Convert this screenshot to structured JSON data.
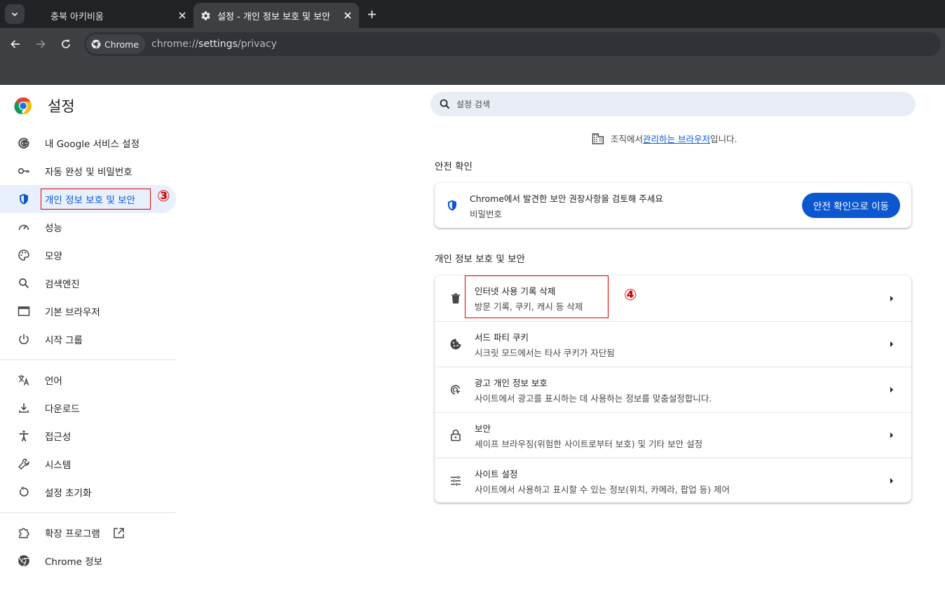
{
  "browser": {
    "tabs": [
      {
        "title": "충북 아키비움",
        "active": false
      },
      {
        "title": "설정 - 개인 정보 보호 및 보안",
        "active": true
      }
    ],
    "chip_label": "Chrome",
    "url_prefix": "chrome://",
    "url_bold": "settings",
    "url_suffix": "/privacy"
  },
  "settings": {
    "title": "설정",
    "search_placeholder": "설정 검색",
    "managed_prefix": "조직에서 ",
    "managed_link": "관리하는 브라우저",
    "managed_suffix": "입니다."
  },
  "sidebar": {
    "items": [
      {
        "label": "내 Google 서비스 설정",
        "icon": "google-g-icon"
      },
      {
        "label": "자동 완성 및 비밀번호",
        "icon": "key-icon"
      },
      {
        "label": "개인 정보 보호 및 보안",
        "icon": "shield-icon",
        "selected": true
      },
      {
        "label": "성능",
        "icon": "speedometer-icon"
      },
      {
        "label": "모양",
        "icon": "palette-icon"
      },
      {
        "label": "검색엔진",
        "icon": "search-icon"
      },
      {
        "label": "기본 브라우저",
        "icon": "browser-window-icon"
      },
      {
        "label": "시작 그룹",
        "icon": "power-icon"
      },
      {
        "label": "언어",
        "icon": "translate-icon"
      },
      {
        "label": "다운로드",
        "icon": "download-icon"
      },
      {
        "label": "접근성",
        "icon": "accessibility-icon"
      },
      {
        "label": "시스템",
        "icon": "wrench-icon"
      },
      {
        "label": "설정 초기화",
        "icon": "reset-icon"
      },
      {
        "label": "확장 프로그램",
        "icon": "extension-icon"
      },
      {
        "label": "Chrome 정보",
        "icon": "chrome-icon"
      }
    ]
  },
  "safety_check": {
    "section_title": "안전 확인",
    "title": "Chrome에서 발견한 보안 권장사항을 검토해 주세요",
    "subtitle": "비밀번호",
    "button": "안전 확인으로 이동"
  },
  "privacy": {
    "section_title": "개인 정보 보호 및 보안",
    "rows": [
      {
        "title": "인터넷 사용 기록 삭제",
        "subtitle": "방문 기록, 쿠키, 캐시 등 삭제",
        "icon": "trash-icon"
      },
      {
        "title": "서드 파티 쿠키",
        "subtitle": "시크릿 모드에서는 타사 쿠키가 자단됨",
        "icon": "cookie-icon"
      },
      {
        "title": "광고 개인 정보 보호",
        "subtitle": "사이트에서 광고를 표시하는 데 사용하는 정보를 맞춤설정합니다.",
        "icon": "ad-privacy-icon"
      },
      {
        "title": "보안",
        "subtitle": "세이프 브라우징(위험한 사이트로부터 보호) 및 기타 보안 설정",
        "icon": "lock-icon"
      },
      {
        "title": "사이트 설정",
        "subtitle": "사이트에서 사용하고 표시할 수 있는 정보(위치, 카메라, 팝업 등) 제어",
        "icon": "tune-icon"
      }
    ]
  },
  "annotations": {
    "step3": "③",
    "step4": "④"
  },
  "colors": {
    "accent": "#0b57d0",
    "selected_bg": "#e8f0fe",
    "annotation_red": "#e00000"
  }
}
